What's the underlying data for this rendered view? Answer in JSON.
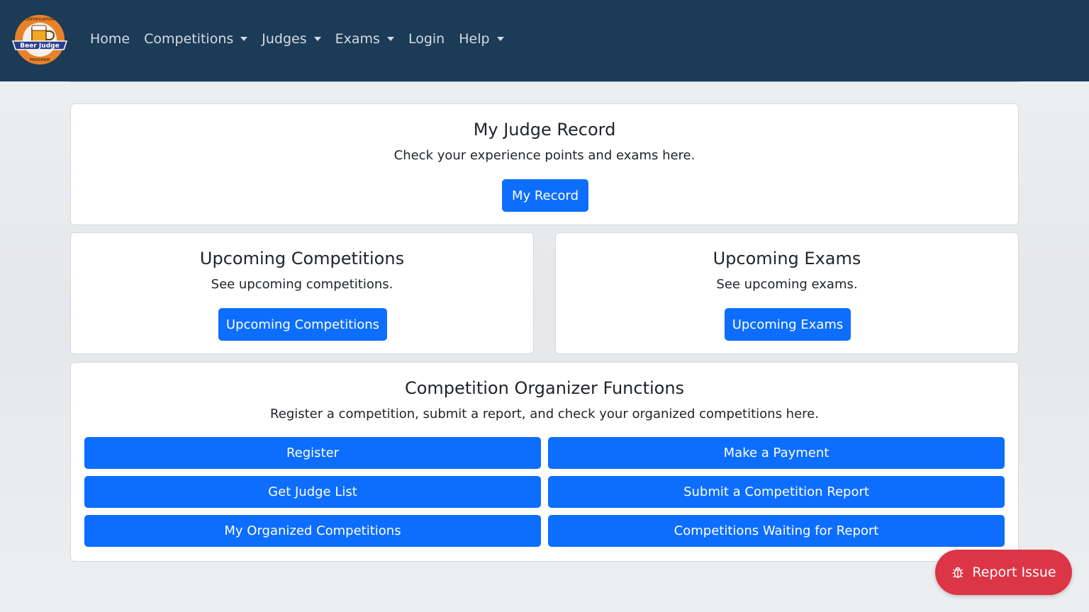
{
  "nav": {
    "logo_top_text": "CERTIFICATION",
    "logo_banner_text": "Beer Judge",
    "logo_bottom_text": "PROGRAM",
    "items": [
      {
        "label": "Home",
        "dropdown": false
      },
      {
        "label": "Competitions",
        "dropdown": true
      },
      {
        "label": "Judges",
        "dropdown": true
      },
      {
        "label": "Exams",
        "dropdown": true
      },
      {
        "label": "Login",
        "dropdown": false
      },
      {
        "label": "Help",
        "dropdown": true
      }
    ]
  },
  "record": {
    "title": "My Judge Record",
    "text": "Check your experience points and exams here.",
    "button": "My Record"
  },
  "competitions": {
    "title": "Upcoming Competitions",
    "text": "See upcoming competitions.",
    "button": "Upcoming Competitions"
  },
  "exams": {
    "title": "Upcoming Exams",
    "text": "See upcoming exams.",
    "button": "Upcoming Exams"
  },
  "organizer": {
    "title": "Competition Organizer Functions",
    "text": "Register a competition, submit a report, and check your organized competitions here.",
    "buttons": [
      "Register",
      "Make a Payment",
      "Get Judge List",
      "Submit a Competition Report",
      "My Organized Competitions",
      "Competitions Waiting for Report"
    ]
  },
  "report_issue": {
    "label": "Report Issue"
  },
  "colors": {
    "navbar": "#1b3b57",
    "primary": "#0d6efd",
    "danger": "#dc3545"
  }
}
